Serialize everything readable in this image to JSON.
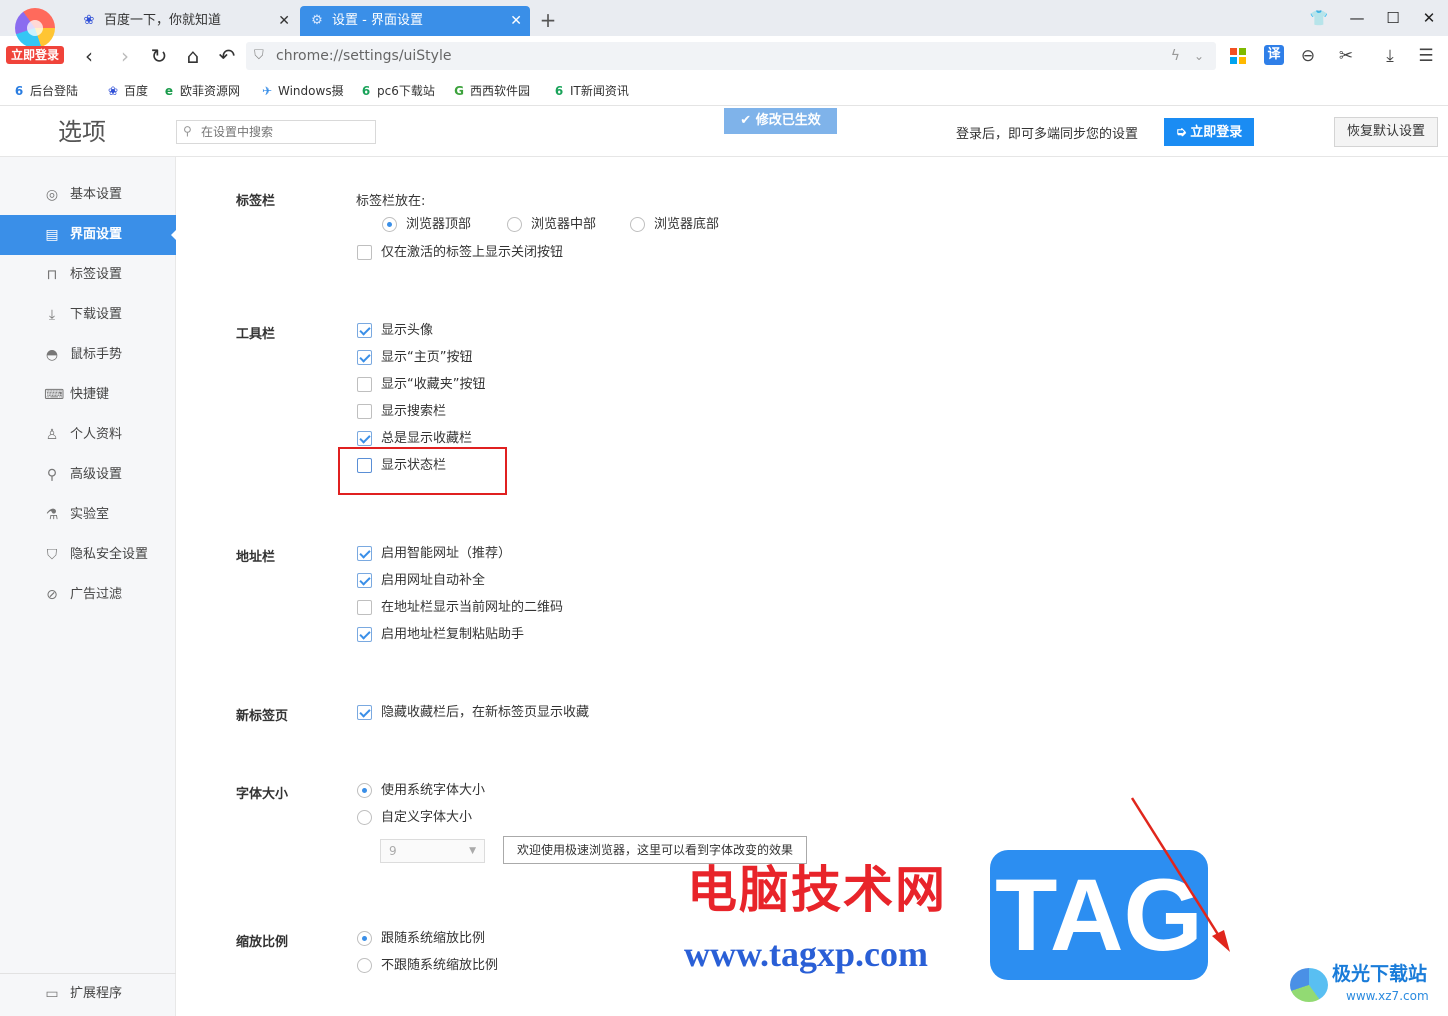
{
  "browser": {
    "login_badge": "立即登录",
    "tabs": [
      {
        "title": "百度一下，你就知道",
        "close": "✕"
      },
      {
        "title": "设置 - 界面设置",
        "close": "✕"
      }
    ],
    "new_tab": "+",
    "address": "chrome://settings/uiStyle",
    "translate_label": "译"
  },
  "bookmarks": [
    {
      "label": "后台登陆",
      "icon": "6"
    },
    {
      "label": "百度",
      "icon": "❀"
    },
    {
      "label": "欧菲资源网",
      "icon": "e"
    },
    {
      "label": "Windows摄",
      "icon": "✈"
    },
    {
      "label": "pc6下载站",
      "icon": "6"
    },
    {
      "label": "西西软件园",
      "icon": "G"
    },
    {
      "label": "IT新闻资讯",
      "icon": "6"
    }
  ],
  "header": {
    "title": "选项",
    "search_placeholder": "在设置中搜索",
    "toast": "修改已生效",
    "login_message": "登录后，即可多端同步您的设置",
    "login_button": "立即登录",
    "reset_button": "恢复默认设置"
  },
  "sidebar": {
    "items": [
      {
        "label": "基本设置",
        "icon": "settings-icon",
        "active": false
      },
      {
        "label": "界面设置",
        "icon": "window-icon",
        "active": true
      },
      {
        "label": "标签设置",
        "icon": "tab-icon",
        "active": false
      },
      {
        "label": "下载设置",
        "icon": "download-icon",
        "active": false
      },
      {
        "label": "鼠标手势",
        "icon": "mouse-icon",
        "active": false
      },
      {
        "label": "快捷键",
        "icon": "keyboard-icon",
        "active": false
      },
      {
        "label": "个人资料",
        "icon": "user-icon",
        "active": false
      },
      {
        "label": "高级设置",
        "icon": "advanced-icon",
        "active": false
      },
      {
        "label": "实验室",
        "icon": "flask-icon",
        "active": false
      },
      {
        "label": "隐私安全设置",
        "icon": "shield-icon",
        "active": false
      },
      {
        "label": "广告过滤",
        "icon": "block-icon",
        "active": false
      }
    ],
    "footer": {
      "label": "扩展程序",
      "icon": "extension-icon"
    }
  },
  "sections": {
    "tabbar": {
      "title": "标签栏",
      "position_label": "标签栏放在:",
      "positions": [
        {
          "label": "浏览器顶部",
          "selected": true
        },
        {
          "label": "浏览器中部",
          "selected": false
        },
        {
          "label": "浏览器底部",
          "selected": false
        }
      ],
      "options": [
        {
          "label": "仅在激活的标签上显示关闭按钮",
          "checked": false
        }
      ]
    },
    "toolbar": {
      "title": "工具栏",
      "options": [
        {
          "label": "显示头像",
          "checked": true
        },
        {
          "label": "显示“主页”按钮",
          "checked": true
        },
        {
          "label": "显示“收藏夹”按钮",
          "checked": false
        },
        {
          "label": "显示搜索栏",
          "checked": false
        },
        {
          "label": "总是显示收藏栏",
          "checked": true
        },
        {
          "label": "显示状态栏",
          "checked": false
        }
      ]
    },
    "addressbar": {
      "title": "地址栏",
      "options": [
        {
          "label": "启用智能网址（推荐）",
          "checked": true
        },
        {
          "label": "启用网址自动补全",
          "checked": true
        },
        {
          "label": "在地址栏显示当前网址的二维码",
          "checked": false
        },
        {
          "label": "启用地址栏复制粘贴助手",
          "checked": true
        }
      ]
    },
    "newtab": {
      "title": "新标签页",
      "options": [
        {
          "label": "隐藏收藏栏后，在新标签页显示收藏",
          "checked": true
        }
      ]
    },
    "fontsize": {
      "title": "字体大小",
      "options": [
        {
          "label": "使用系统字体大小",
          "selected": true
        },
        {
          "label": "自定义字体大小",
          "selected": false
        }
      ],
      "size_value": "9",
      "preview_text": "欢迎使用极速浏览器，这里可以看到字体改变的效果"
    },
    "zoom": {
      "title": "缩放比例",
      "options": [
        {
          "label": "跟随系统缩放比例",
          "selected": true
        },
        {
          "label": "不跟随系统缩放比例",
          "selected": false
        }
      ]
    }
  },
  "watermark": {
    "cn": "电脑技术网",
    "url": "www.tagxp.com",
    "tag": "TAG",
    "corner_title": "极光下载站",
    "corner_url": "www.xz7.com"
  }
}
